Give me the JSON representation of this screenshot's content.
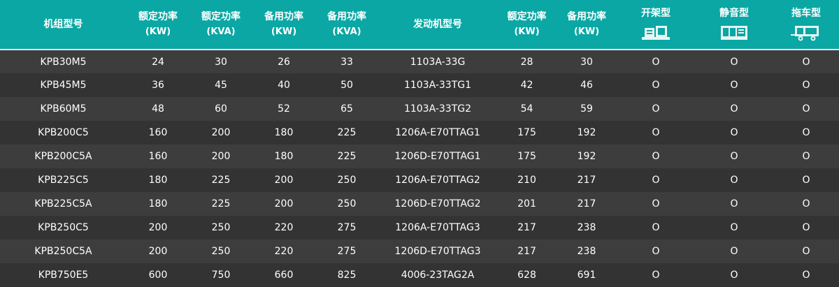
{
  "colors": {
    "header_bg": "#0aa7a4",
    "row_odd": "#3d3d3d",
    "row_even": "#333333",
    "text": "#ffffff"
  },
  "headers": [
    {
      "label": "机组型号",
      "unit": ""
    },
    {
      "label": "额定功率",
      "unit": "(KW)"
    },
    {
      "label": "额定功率",
      "unit": "(KVA)"
    },
    {
      "label": "备用功率",
      "unit": "(KW)"
    },
    {
      "label": "备用功率",
      "unit": "(KVA)"
    },
    {
      "label": "发动机型号",
      "unit": ""
    },
    {
      "label": "额定功率",
      "unit": "(KW)"
    },
    {
      "label": "备用功率",
      "unit": "(KW)"
    },
    {
      "label": "开架型",
      "icon": "open-frame-generator-icon"
    },
    {
      "label": "静音型",
      "icon": "silent-generator-icon"
    },
    {
      "label": "拖车型",
      "icon": "trailer-generator-icon"
    }
  ],
  "rows": [
    [
      "KPB30M5",
      "24",
      "30",
      "26",
      "33",
      "1103A-33G",
      "28",
      "30",
      "O",
      "O",
      "O"
    ],
    [
      "KPB45M5",
      "36",
      "45",
      "40",
      "50",
      "1103A-33TG1",
      "42",
      "46",
      "O",
      "O",
      "O"
    ],
    [
      "KPB60M5",
      "48",
      "60",
      "52",
      "65",
      "1103A-33TG2",
      "54",
      "59",
      "O",
      "O",
      "O"
    ],
    [
      "KPB200C5",
      "160",
      "200",
      "180",
      "225",
      "1206A-E70TTAG1",
      "175",
      "192",
      "O",
      "O",
      "O"
    ],
    [
      "KPB200C5A",
      "160",
      "200",
      "180",
      "225",
      "1206D-E70TTAG1",
      "175",
      "192",
      "O",
      "O",
      "O"
    ],
    [
      "KPB225C5",
      "180",
      "225",
      "200",
      "250",
      "1206A-E70TTAG2",
      "210",
      "217",
      "O",
      "O",
      "O"
    ],
    [
      "KPB225C5A",
      "180",
      "225",
      "200",
      "250",
      "1206D-E70TTAG2",
      "201",
      "217",
      "O",
      "O",
      "O"
    ],
    [
      "KPB250C5",
      "200",
      "250",
      "220",
      "275",
      "1206A-E70TTAG3",
      "217",
      "238",
      "O",
      "O",
      "O"
    ],
    [
      "KPB250C5A",
      "200",
      "250",
      "220",
      "275",
      "1206D-E70TTAG3",
      "217",
      "238",
      "O",
      "O",
      "O"
    ],
    [
      "KPB750E5",
      "600",
      "750",
      "660",
      "825",
      "4006-23TAG2A",
      "628",
      "691",
      "O",
      "O",
      "O"
    ]
  ]
}
